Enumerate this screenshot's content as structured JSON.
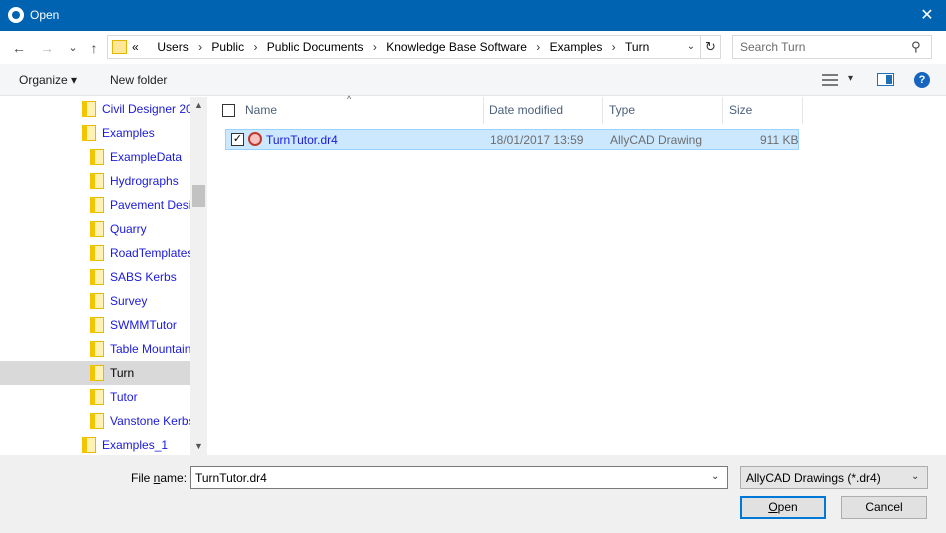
{
  "window": {
    "title": "Open",
    "close_glyph": "✕"
  },
  "nav": {
    "back_glyph": "←",
    "forward_glyph": "→",
    "recent_glyph": "⌄",
    "up_glyph": "↑",
    "overflow": "«",
    "breadcrumbs": [
      "Users",
      "Public",
      "Public Documents",
      "Knowledge Base Software",
      "Examples",
      "Turn"
    ],
    "separator": "›",
    "address_dropdown_glyph": "⌄",
    "refresh_glyph": "↻"
  },
  "search": {
    "placeholder": "Search Turn",
    "icon_glyph": "⚲"
  },
  "toolbar": {
    "organize_label": "Organize ▾",
    "new_folder_label": "New folder",
    "view_dropdown_glyph": "▾",
    "help_glyph": "?"
  },
  "tree": {
    "items": [
      {
        "label": "Civil Designer 20",
        "level": 1,
        "selected": false
      },
      {
        "label": "Examples",
        "level": 1,
        "selected": false
      },
      {
        "label": "ExampleData",
        "level": 2,
        "selected": false
      },
      {
        "label": "Hydrographs",
        "level": 2,
        "selected": false
      },
      {
        "label": "Pavement Desi",
        "level": 2,
        "selected": false
      },
      {
        "label": "Quarry",
        "level": 2,
        "selected": false
      },
      {
        "label": "RoadTemplates",
        "level": 2,
        "selected": false
      },
      {
        "label": "SABS Kerbs",
        "level": 2,
        "selected": false
      },
      {
        "label": "Survey",
        "level": 2,
        "selected": false
      },
      {
        "label": "SWMMTutor",
        "level": 2,
        "selected": false
      },
      {
        "label": "Table Mountain",
        "level": 2,
        "selected": false
      },
      {
        "label": "Turn",
        "level": 2,
        "selected": true
      },
      {
        "label": "Tutor",
        "level": 2,
        "selected": false
      },
      {
        "label": "Vanstone Kerbs",
        "level": 2,
        "selected": false
      },
      {
        "label": "Examples_1",
        "level": 1,
        "selected": false
      }
    ],
    "scroll_up_glyph": "▲",
    "scroll_down_glyph": "▼"
  },
  "file_list": {
    "columns": [
      "Name",
      "Date modified",
      "Type",
      "Size"
    ],
    "sort_glyph": "^",
    "rows": [
      {
        "name": "TurnTutor.dr4",
        "date": "18/01/2017 13:59",
        "type": "AllyCAD Drawing",
        "size": "911 KB",
        "checked": true
      }
    ],
    "check_glyph": "✓"
  },
  "footer": {
    "file_name_label_pre": "File ",
    "file_name_label_u": "n",
    "file_name_label_post": "ame:",
    "file_name_value": "TurnTutor.dr4",
    "dropdown_glyph": "⌄",
    "file_type_value": "AllyCAD Drawings (*.dr4)",
    "open_label_u": "O",
    "open_label_rest": "pen",
    "cancel_label": "Cancel"
  },
  "colors": {
    "titlebar": "#0063b1",
    "selection": "#cce8ff",
    "tree_link": "#1a1adb",
    "primary_button_border": "#0078d7"
  }
}
